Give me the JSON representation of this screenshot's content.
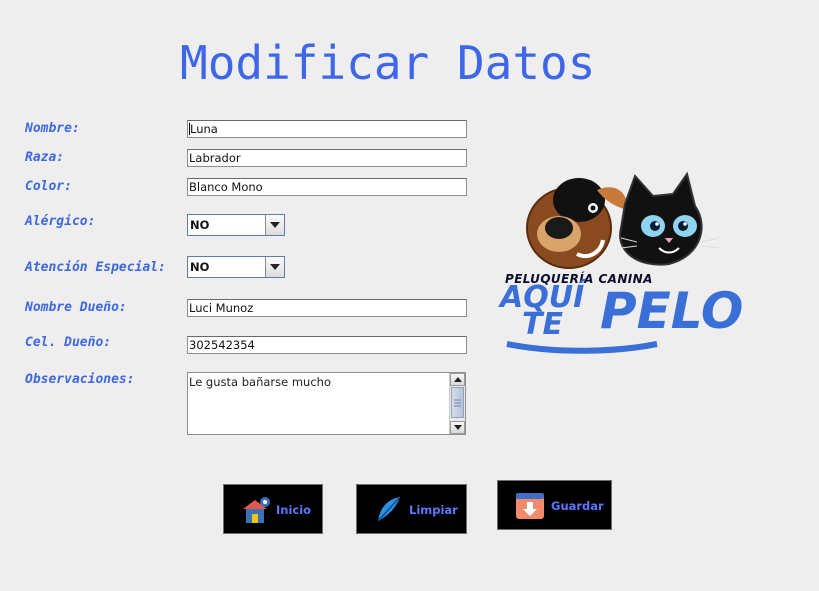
{
  "title": "Modificar Datos",
  "labels": {
    "nombre": "Nombre:",
    "raza": "Raza:",
    "color": "Color:",
    "alergico": "Alérgico:",
    "atencion": "Atención Especial:",
    "dueno": "Nombre Dueño:",
    "cel": "Cel. Dueño:",
    "obs": "Observaciones:"
  },
  "values": {
    "nombre": "Luna",
    "raza": "Labrador",
    "color": "Blanco Mono",
    "alergico": "NO",
    "atencion": "NO",
    "dueno": "Luci Munoz",
    "cel": "302542354",
    "obs": "Le gusta bañarse mucho"
  },
  "buttons": {
    "inicio": "Inicio",
    "limpiar": "Limpiar",
    "guardar": "Guardar"
  },
  "logo": {
    "line1": "PELUQUERÍA   CANINA",
    "aqui": "AQUÍ",
    "te": "TE",
    "pelo": "PELO"
  },
  "colors": {
    "accent": "#3d66e8",
    "button_bg": "#000000",
    "button_text": "#5a78ff"
  }
}
